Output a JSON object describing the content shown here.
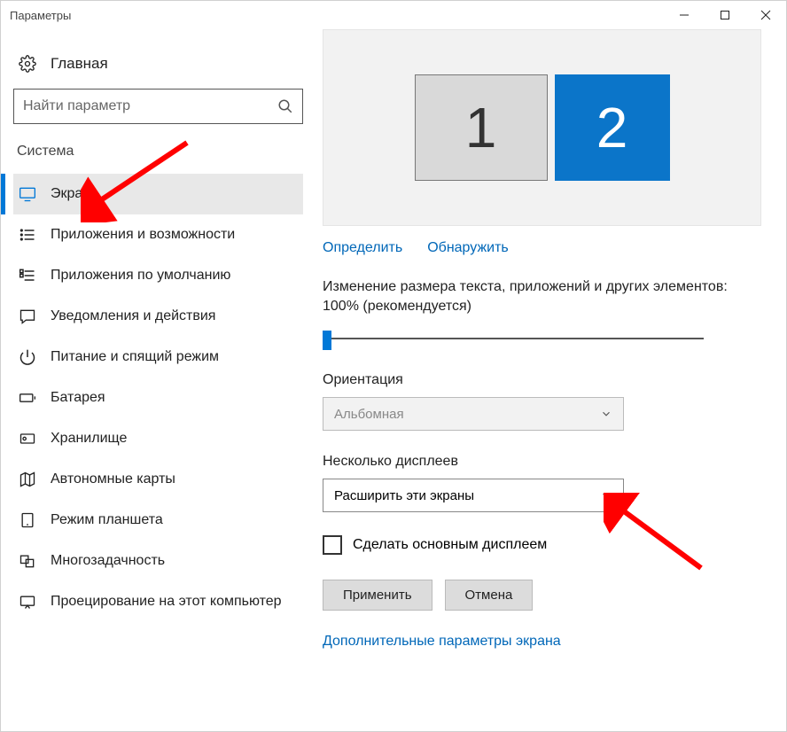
{
  "window": {
    "title": "Параметры"
  },
  "home": {
    "label": "Главная"
  },
  "search": {
    "placeholder": "Найти параметр"
  },
  "section": {
    "title": "Система"
  },
  "nav": {
    "display": "Экран",
    "apps": "Приложения и возможности",
    "default_apps": "Приложения по умолчанию",
    "notifications": "Уведомления и действия",
    "power": "Питание и спящий режим",
    "battery": "Батарея",
    "storage": "Хранилище",
    "offline_maps": "Автономные карты",
    "tablet": "Режим планшета",
    "multitasking": "Многозадачность",
    "projecting": "Проецирование на этот компьютер"
  },
  "monitors": {
    "m1": "1",
    "m2": "2"
  },
  "links": {
    "identify": "Определить",
    "detect": "Обнаружить"
  },
  "scale": {
    "desc": "Изменение размера текста, приложений и других элементов: 100% (рекомендуется)"
  },
  "orientation": {
    "label": "Ориентация",
    "value": "Альбомная"
  },
  "multiple": {
    "label": "Несколько дисплеев",
    "value": "Расширить эти экраны"
  },
  "checkbox": {
    "label": "Сделать основным дисплеем"
  },
  "buttons": {
    "apply": "Применить",
    "cancel": "Отмена"
  },
  "advanced": {
    "label": "Дополнительные параметры экрана"
  }
}
